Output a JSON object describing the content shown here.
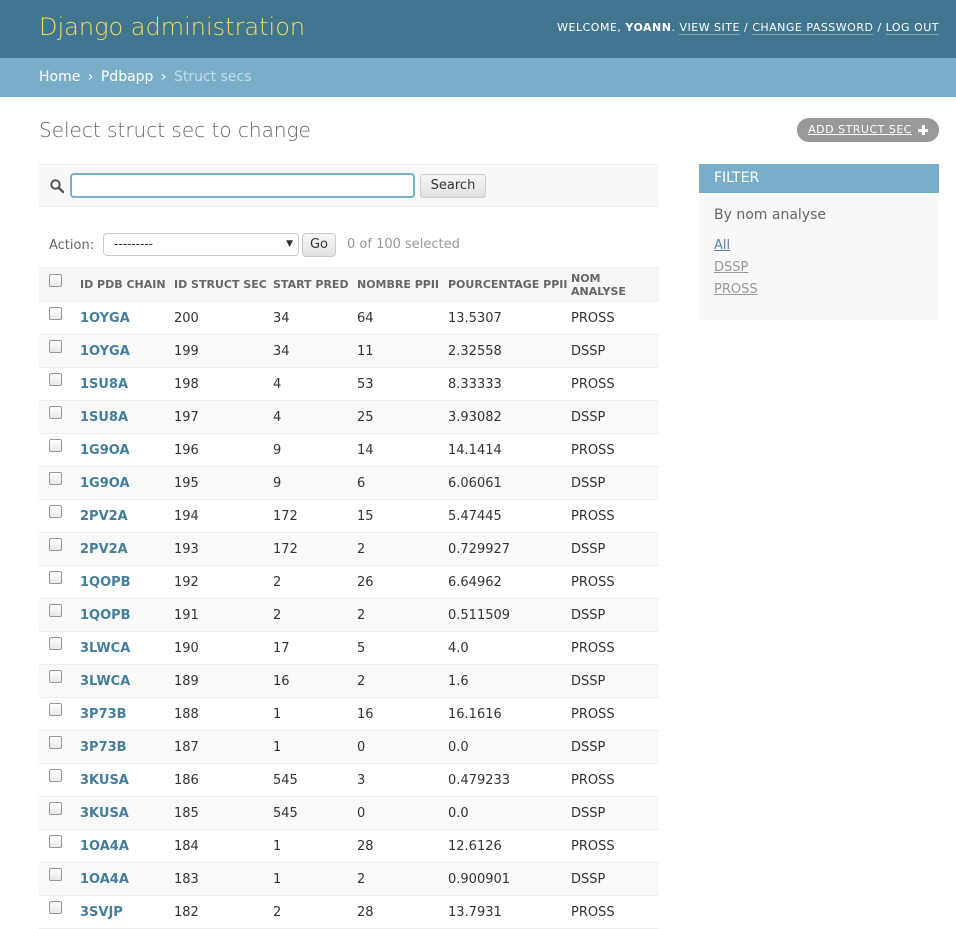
{
  "header": {
    "site_title": "Django administration",
    "welcome": "WELCOME,",
    "username": "YOANN",
    "view_site": "VIEW SITE",
    "change_password": "CHANGE PASSWORD",
    "log_out": "LOG OUT",
    "sep": "/"
  },
  "breadcrumbs": {
    "home": "Home",
    "app": "Pdbapp",
    "current": "Struct secs",
    "sep": "›"
  },
  "page": {
    "title": "Select struct sec to change",
    "add_button": "ADD STRUCT SEC"
  },
  "search": {
    "value": "",
    "button": "Search",
    "icon": "search-icon"
  },
  "actions": {
    "label": "Action:",
    "selected_option": "---------",
    "go": "Go",
    "counter": "0 of 100 selected"
  },
  "table": {
    "columns": [
      "ID PDB CHAIN",
      "ID STRUCT SEC",
      "START PRED",
      "NOMBRE PPII",
      "POURCENTAGE PPII",
      "NOM ANALYSE"
    ],
    "rows": [
      [
        "1OYGA",
        "200",
        "34",
        "64",
        "13.5307",
        "PROSS"
      ],
      [
        "1OYGA",
        "199",
        "34",
        "11",
        "2.32558",
        "DSSP"
      ],
      [
        "1SU8A",
        "198",
        "4",
        "53",
        "8.33333",
        "PROSS"
      ],
      [
        "1SU8A",
        "197",
        "4",
        "25",
        "3.93082",
        "DSSP"
      ],
      [
        "1G9OA",
        "196",
        "9",
        "14",
        "14.1414",
        "PROSS"
      ],
      [
        "1G9OA",
        "195",
        "9",
        "6",
        "6.06061",
        "DSSP"
      ],
      [
        "2PV2A",
        "194",
        "172",
        "15",
        "5.47445",
        "PROSS"
      ],
      [
        "2PV2A",
        "193",
        "172",
        "2",
        "0.729927",
        "DSSP"
      ],
      [
        "1QOPB",
        "192",
        "2",
        "26",
        "6.64962",
        "PROSS"
      ],
      [
        "1QOPB",
        "191",
        "2",
        "2",
        "0.511509",
        "DSSP"
      ],
      [
        "3LWCA",
        "190",
        "17",
        "5",
        "4.0",
        "PROSS"
      ],
      [
        "3LWCA",
        "189",
        "16",
        "2",
        "1.6",
        "DSSP"
      ],
      [
        "3P73B",
        "188",
        "1",
        "16",
        "16.1616",
        "PROSS"
      ],
      [
        "3P73B",
        "187",
        "1",
        "0",
        "0.0",
        "DSSP"
      ],
      [
        "3KUSA",
        "186",
        "545",
        "3",
        "0.479233",
        "PROSS"
      ],
      [
        "3KUSA",
        "185",
        "545",
        "0",
        "0.0",
        "DSSP"
      ],
      [
        "1OA4A",
        "184",
        "1",
        "28",
        "12.6126",
        "PROSS"
      ],
      [
        "1OA4A",
        "183",
        "1",
        "2",
        "0.900901",
        "DSSP"
      ],
      [
        "3SVJP",
        "182",
        "2",
        "28",
        "13.7931",
        "PROSS"
      ]
    ]
  },
  "filter": {
    "heading": "FILTER",
    "subheading": "By nom analyse",
    "options": [
      "All",
      "DSSP",
      "PROSS"
    ],
    "selected": "All"
  }
}
